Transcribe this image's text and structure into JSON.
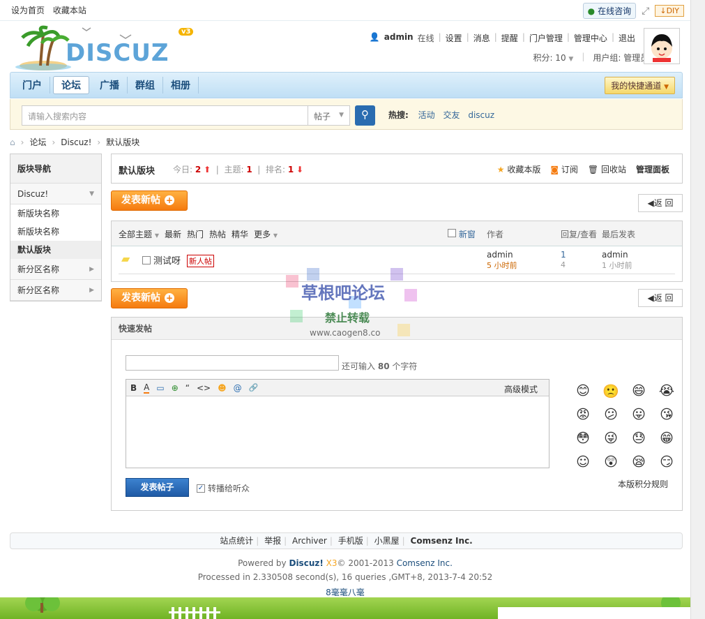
{
  "topbar": {
    "set_home": "设为首页",
    "bookmark": "收藏本站",
    "online_consult": "在线咨询",
    "diy": "DIY"
  },
  "header": {
    "logo_text": "DISCUZ",
    "logo_version": "v3",
    "user": {
      "name": "admin",
      "status": "在线",
      "links": [
        "设置",
        "消息",
        "提醒",
        "门户管理",
        "管理中心",
        "退出"
      ],
      "points": "积分: 10",
      "group": "用户组: 管理员"
    }
  },
  "nav": {
    "items": [
      "门户",
      "论坛",
      "广播",
      "群组",
      "相册"
    ],
    "active_index": 1,
    "quick": "我的快捷通道"
  },
  "search": {
    "placeholder": "请输入搜索内容",
    "type": "帖子",
    "hot_label": "热搜:",
    "hot_terms": [
      "活动",
      "交友",
      "discuz"
    ]
  },
  "breadcrumb": [
    "论坛",
    "Discuz!",
    "默认版块"
  ],
  "sidebar": {
    "title": "版块导航",
    "group1": "Discuz!",
    "subs": [
      "新版块名称",
      "新版块名称",
      "默认版块"
    ],
    "current_index": 2,
    "group2": "新分区名称",
    "group3": "新分区名称"
  },
  "forum": {
    "name": "默认版块",
    "today_label": "今日:",
    "today": "2",
    "topics_label": "主题:",
    "topics": "1",
    "rank_label": "排名:",
    "rank": "1",
    "actions": [
      "收藏本版",
      "订阅",
      "回收站",
      "管理面板"
    ]
  },
  "buttons": {
    "new_post": "发表新帖",
    "back": "返 回"
  },
  "thread_list": {
    "filters": [
      "全部主题",
      "最新",
      "热门",
      "热帖",
      "精华",
      "更多"
    ],
    "new_window": "新窗",
    "col_author": "作者",
    "col_replies": "回复/查看",
    "col_last": "最后发表",
    "rows": [
      {
        "title": "测试呀",
        "badge": "新人帖",
        "author": "admin",
        "author_time": "5 小时前",
        "replies": "1",
        "views": "4",
        "last_author": "admin",
        "last_time": "1 小时前"
      }
    ]
  },
  "quick_post": {
    "title": "快速发帖",
    "remain_prefix": "还可输入",
    "remain_count": "80",
    "remain_suffix": "个字符",
    "toolbar": [
      "B",
      "A",
      "▭",
      "⊕",
      "“",
      "<>",
      "☻",
      "@",
      "🔗"
    ],
    "advanced": "高级模式",
    "submit": "发表帖子",
    "broadcast": "转播给听众",
    "rules": "本版积分规则"
  },
  "footer": {
    "links": [
      "站点统计",
      "举报",
      "Archiver",
      "手机版",
      "小黑屋",
      "Comsenz Inc."
    ],
    "powered_prefix": "Powered by",
    "powered_name": "Discuz!",
    "powered_ver": "X3",
    "copyright": "© 2001-2013",
    "company": "Comsenz Inc.",
    "processed": "Processed in 2.330508 second(s), 16 queries ,GMT+8, 2013-7-4 20:52",
    "tagline": "8毫毫八毫"
  },
  "watermark": {
    "line1": "草根吧论坛",
    "line2": "禁止转载",
    "line3": "www.caogen8.co"
  },
  "colors": {
    "accent_blue": "#1c4e7c",
    "orange": "#f57b0f",
    "red_stat": "#cc0000"
  }
}
